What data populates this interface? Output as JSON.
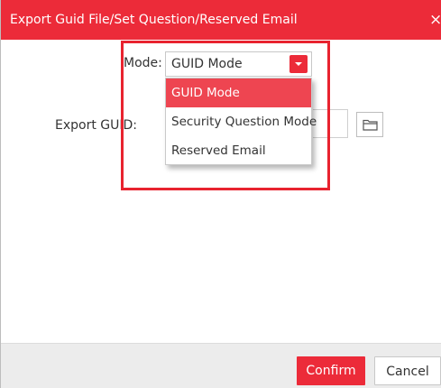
{
  "dialog": {
    "title": "Export Guid File/Set Question/Reserved Email",
    "close_symbol": "×",
    "close_icon": "close-icon"
  },
  "mode": {
    "label": "Mode:",
    "selected": "GUID Mode",
    "options": [
      {
        "label": "GUID Mode",
        "selected": true
      },
      {
        "label": "Security Question Mode",
        "selected": false
      },
      {
        "label": "Reserved Email",
        "selected": false
      }
    ]
  },
  "export_guid": {
    "label": "Export GUID:",
    "value": "",
    "browse_icon": "folder-icon"
  },
  "footer": {
    "confirm_label": "Confirm",
    "cancel_label": "Cancel"
  },
  "colors": {
    "accent": "#ec2b39",
    "highlight_box": "#e8232f",
    "footer_bg": "#ececec"
  }
}
